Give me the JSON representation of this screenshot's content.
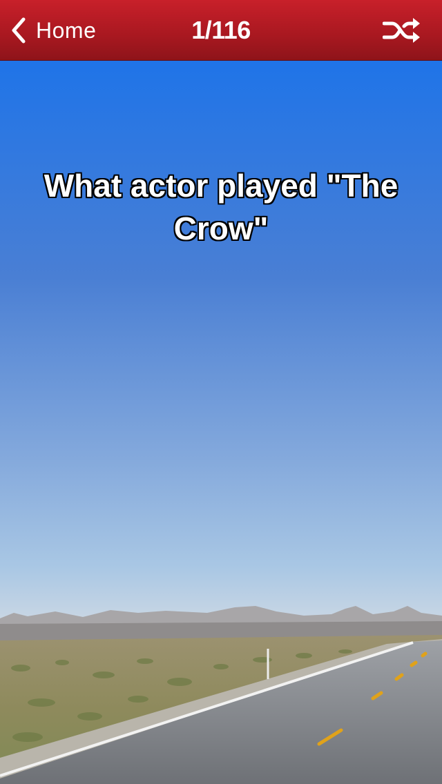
{
  "navbar": {
    "back_label": "Home",
    "title": "1/116",
    "back_icon": "chevron-left-icon",
    "shuffle_icon": "shuffle-icon"
  },
  "card": {
    "question": "What actor played \"The Crow\""
  },
  "colors": {
    "navbar": "#a81820",
    "sky_top": "#1f74e8",
    "sky_bottom": "#e6ebf0",
    "text": "#ffffff"
  }
}
